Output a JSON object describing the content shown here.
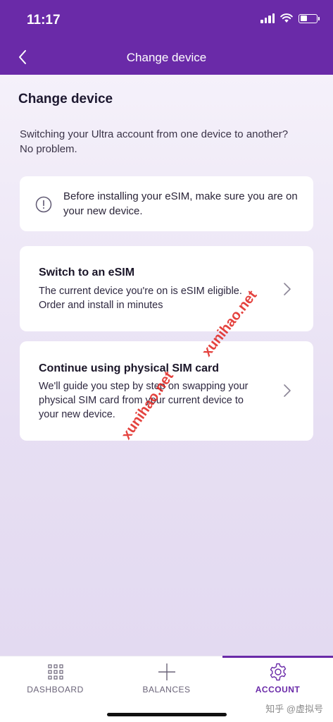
{
  "status": {
    "time": "11:17"
  },
  "nav": {
    "title": "Change device"
  },
  "page": {
    "title": "Change device",
    "intro": "Switching your Ultra account from one device to another? No problem."
  },
  "notice": {
    "text": "Before installing your eSIM, make sure you are on your new device."
  },
  "options": [
    {
      "title": "Switch to an eSIM",
      "description": "The current device you're on is eSIM eligible. Order and install in minutes"
    },
    {
      "title": "Continue using physical SIM card",
      "description": "We'll guide you step by step on swapping your physical SIM card from your current device to your new device."
    }
  ],
  "watermark": {
    "text": "xunihao.net"
  },
  "tabs": [
    {
      "label": "DASHBOARD",
      "icon": "grid-icon"
    },
    {
      "label": "BALANCES",
      "icon": "plus-icon"
    },
    {
      "label": "ACCOUNT",
      "icon": "gear-icon",
      "active": true
    }
  ],
  "corner_mark": "知乎 @虚拟号",
  "colors": {
    "brand": "#6a2aa8",
    "watermark": "#e0221d"
  }
}
